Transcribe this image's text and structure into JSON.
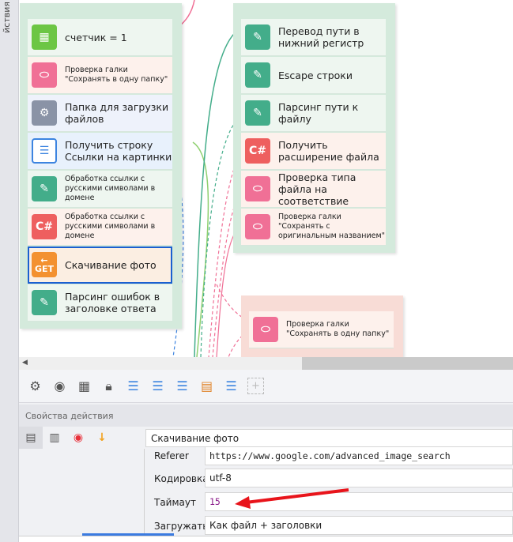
{
  "sidebar": {
    "label": "йствия"
  },
  "canvas": {
    "group_left": [
      {
        "label": "счетчик  = 1",
        "icon": "grid-icon",
        "color": "#6cc644",
        "bg": "#eef6f0",
        "small": false
      },
      {
        "label": "Проверка галки \"Сохранять в одну папку\"",
        "icon": "toggle-icon",
        "color": "#f07096",
        "bg": "#fdf1ec",
        "small": true
      },
      {
        "label": "Папка для загрузки файлов",
        "icon": "gear-icon",
        "color": "#8a93a6",
        "bg": "#eef2fb",
        "small": false
      },
      {
        "label": "Получить строку Ссылки на картинки",
        "icon": "list-icon",
        "color": "#3c84e0",
        "bg": "#e8f1fc",
        "small": false
      },
      {
        "label": "Обработка ссылки с русскими символами в домене",
        "icon": "pencil-icon",
        "color": "#43ad8a",
        "bg": "#eef6f0",
        "small": true
      },
      {
        "label": "Обработка ссылки с русскими символами в домене",
        "icon": "csharp-icon",
        "color": "#ee5f5f",
        "bg": "#fdf1ec",
        "small": true
      },
      {
        "label": "Скачивание фото",
        "icon": "get-icon",
        "color": "#f39130",
        "bg": "#fbeee2",
        "small": false
      },
      {
        "label": "Парсинг ошибок в заголовке ответа",
        "icon": "pencil-icon",
        "color": "#43ad8a",
        "bg": "#eef6f0",
        "small": false
      }
    ],
    "group_right": [
      {
        "label": "Перевод пути в нижний регистр",
        "icon": "pencil-icon",
        "color": "#43ad8a",
        "bg": "#eef6f0",
        "small": false
      },
      {
        "label": "Escape строки",
        "icon": "pencil-icon",
        "color": "#43ad8a",
        "bg": "#eef6f0",
        "small": false
      },
      {
        "label": "Парсинг пути к файлу",
        "icon": "pencil-icon",
        "color": "#43ad8a",
        "bg": "#eef6f0",
        "small": false
      },
      {
        "label": "Получить расширение файла",
        "icon": "csharp-icon",
        "color": "#ee5f5f",
        "bg": "#fdf1ec",
        "small": false
      },
      {
        "label": "Проверка типа файла на соответствие",
        "icon": "toggle-icon",
        "color": "#f07096",
        "bg": "#fdf1ec",
        "small": false
      },
      {
        "label": "Проверка галки \"Сохранять с оригинальным названием\"",
        "icon": "toggle-icon",
        "color": "#f07096",
        "bg": "#fdf1ec",
        "small": true
      }
    ],
    "group_pink": [
      {
        "label": "Проверка галки \"Сохранять в одну папку\"",
        "icon": "toggle-icon",
        "color": "#f07096",
        "bg": "#fdf1ec",
        "small": true
      }
    ]
  },
  "properties": {
    "header": "Свойства действия",
    "action_name": "Скачивание фото",
    "fields": [
      {
        "label": "Referer",
        "value": "https://www.google.com/advanced_image_search",
        "mono": true
      },
      {
        "label": "Кодировка",
        "value": "utf-8",
        "mono": false
      },
      {
        "label": "Таймаут",
        "value": "15",
        "mono": true
      },
      {
        "label": "Загружать",
        "value": "Как файл + заголовки",
        "mono": false
      }
    ]
  },
  "colors": {
    "selected": "#1a5fd0",
    "arrow": "#e8141b",
    "timeout_value": "#8b1c8b"
  }
}
